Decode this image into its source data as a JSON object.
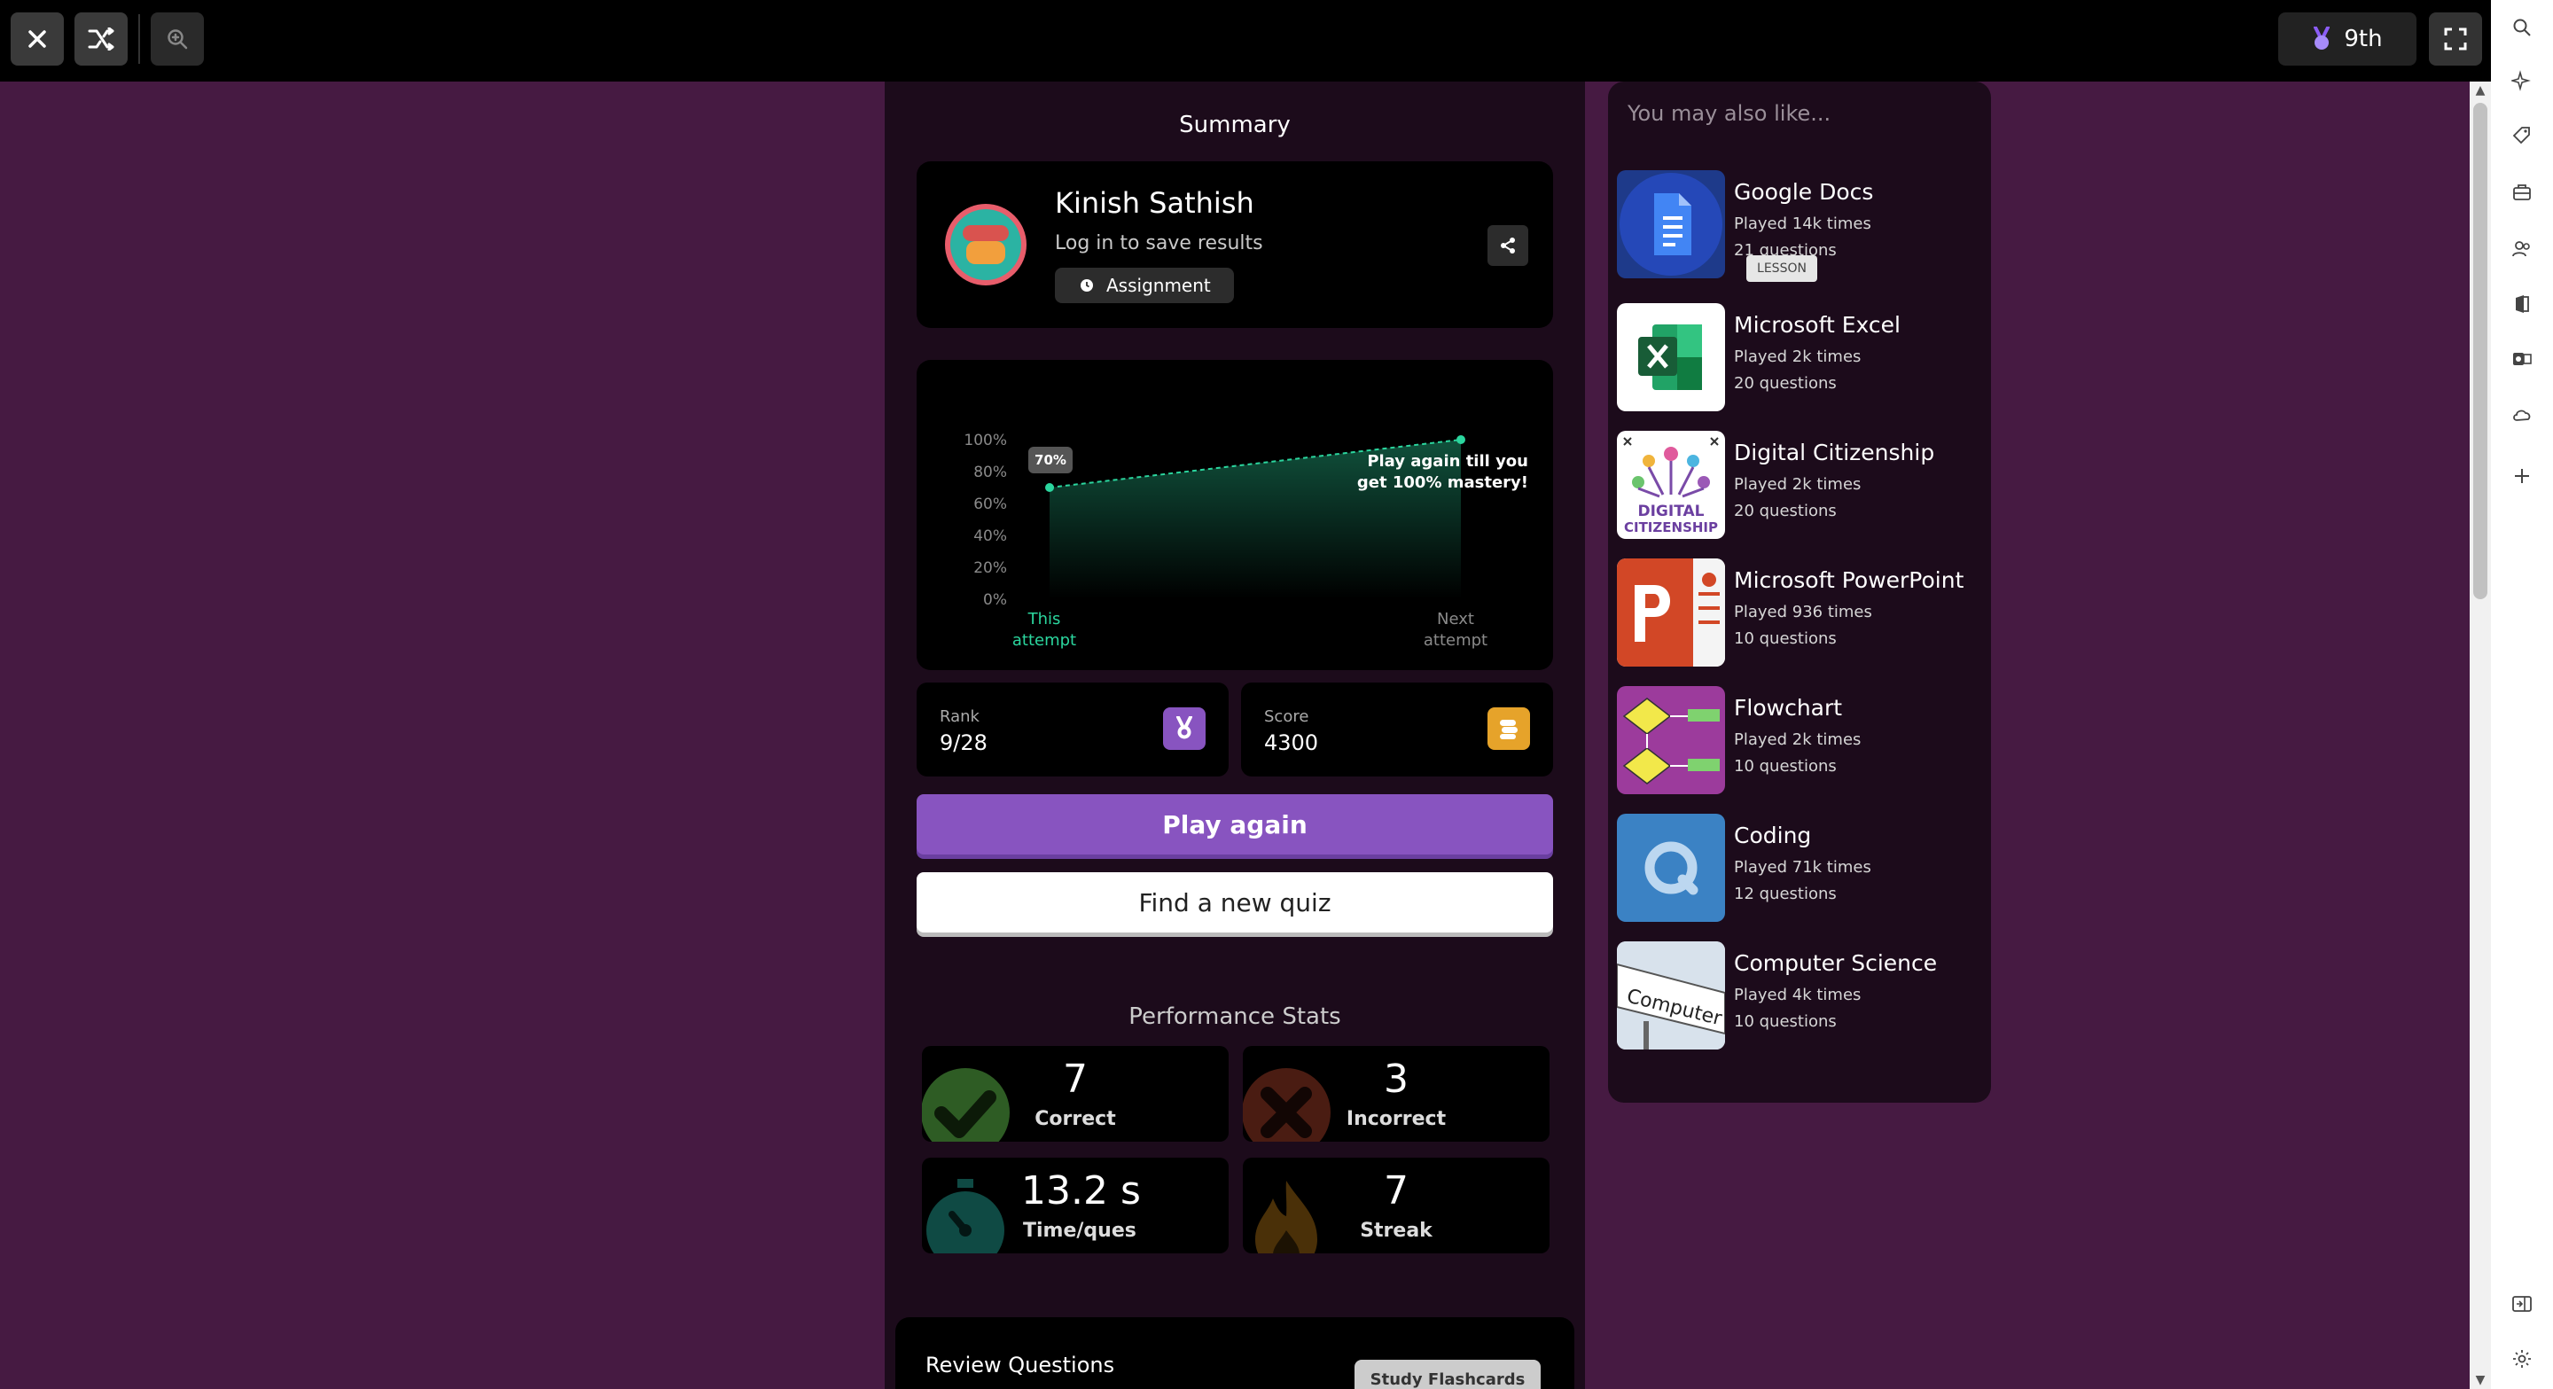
{
  "topbar": {
    "rank": "9th",
    "icons": [
      "close-icon",
      "shuffle-icon",
      "zoom-icon",
      "medal-icon",
      "fullscreen-icon"
    ]
  },
  "summary": {
    "title": "Summary",
    "name": "Kinish Sathish",
    "subtitle": "Log in to save results",
    "badge": "Assignment"
  },
  "chart_data": {
    "type": "area",
    "y_ticks": [
      "100%",
      "80%",
      "60%",
      "40%",
      "20%",
      "0%"
    ],
    "ylim": [
      0,
      100
    ],
    "categories": [
      "This attempt",
      "Next attempt"
    ],
    "values": [
      70,
      100
    ],
    "point_label": "70%",
    "annotation": [
      "Play again till you",
      "get 100% mastery!"
    ],
    "accent": "#2bd69e"
  },
  "stats": {
    "rank_label": "Rank",
    "rank_value": "9/28",
    "score_label": "Score",
    "score_value": "4300"
  },
  "buttons": {
    "play_again": "Play again",
    "find_quiz": "Find a new quiz"
  },
  "performance": {
    "title": "Performance Stats",
    "correct_value": "7",
    "correct_label": "Correct",
    "incorrect_value": "3",
    "incorrect_label": "Incorrect",
    "time_value": "13.2 s",
    "time_label": "Time/ques",
    "streak_value": "7",
    "streak_label": "Streak"
  },
  "review": {
    "title": "Review Questions",
    "study_button": "Study Flashcards"
  },
  "recommendations": {
    "title": "You may also like...",
    "lesson_badge": "LESSON",
    "items": [
      {
        "title": "Google Docs",
        "played": "Played 14k times",
        "questions": "21 questions",
        "icon": "google-docs-icon"
      },
      {
        "title": "Microsoft Excel",
        "played": "Played 2k times",
        "questions": "20 questions",
        "icon": "excel-icon"
      },
      {
        "title": "Digital Citizenship",
        "played": "Played 2k times",
        "questions": "20 questions",
        "icon": "digital-citizenship-icon",
        "thumb_text": [
          "DIGITAL",
          "CITIZENSHIP"
        ]
      },
      {
        "title": "Microsoft PowerPoint",
        "played": "Played 936 times",
        "questions": "10 questions",
        "icon": "powerpoint-icon"
      },
      {
        "title": "Flowchart",
        "played": "Played 2k times",
        "questions": "10 questions",
        "icon": "flowchart-icon"
      },
      {
        "title": "Coding",
        "played": "Played 71k times",
        "questions": "12 questions",
        "icon": "coding-icon"
      },
      {
        "title": "Computer Science",
        "played": "Played 4k times",
        "questions": "10 questions",
        "icon": "computer-science-icon",
        "thumb_text": "Computer Sci"
      }
    ]
  },
  "browser_sidebar": {
    "icons": [
      "search-icon",
      "sparkle-icon",
      "tag-icon",
      "toolbox-icon",
      "people-icon",
      "office-icon",
      "outlook-icon",
      "cloud-icon",
      "add-icon",
      "sidebar-toggle-icon",
      "settings-icon"
    ]
  },
  "colors": {
    "background": "#461a42",
    "panel": "#1c0b1b",
    "purple": "#8854c0",
    "green": "#2bd69e",
    "gold": "#e6a32a"
  }
}
